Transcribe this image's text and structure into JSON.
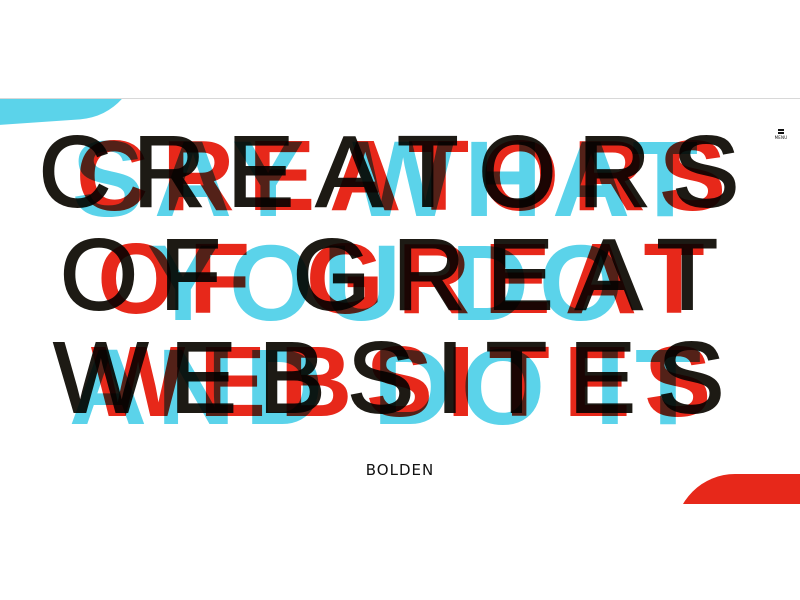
{
  "header": {
    "menu_label": "MENU"
  },
  "hero": {
    "layers": {
      "cyan": [
        "SAY WHAT",
        "YOU DO",
        "AND DO IT"
      ],
      "red": [
        "CREATORS",
        "OF GREAT",
        "WEBSITES"
      ],
      "black": [
        "CREATORS",
        "OF GREAT",
        "WEBSITES"
      ]
    }
  },
  "brand": {
    "logo_text": "BOLDEN"
  },
  "colors": {
    "cyan": "#5bd3ea",
    "red": "#e7281a",
    "black": "#1d1a14"
  }
}
